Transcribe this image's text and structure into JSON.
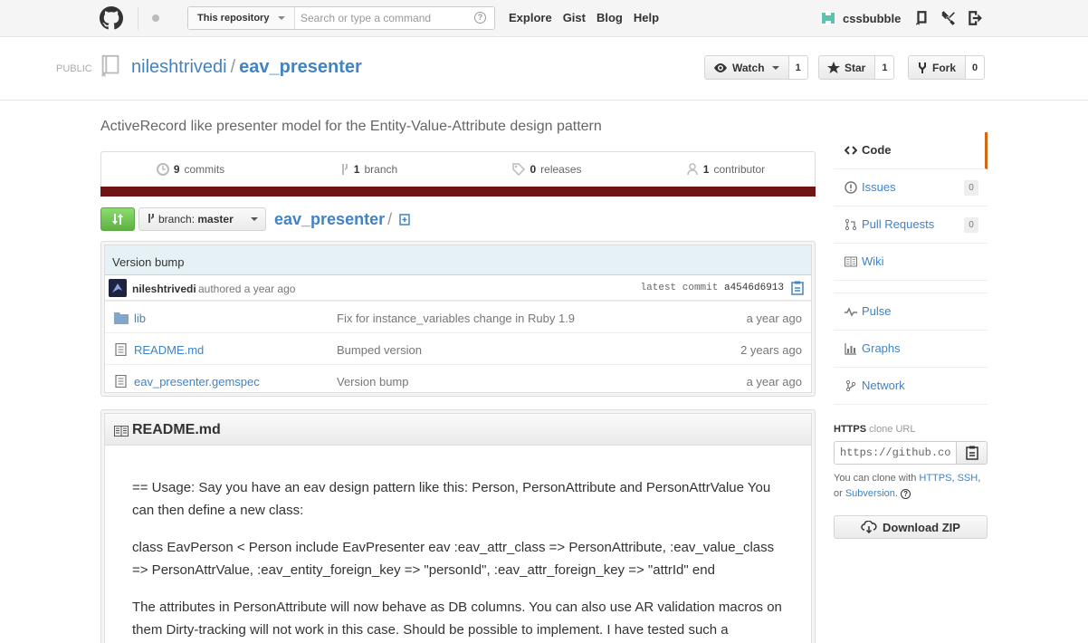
{
  "header": {
    "scope_label": "This repository",
    "search_placeholder": "Search or type a command",
    "search_help": "?",
    "nav": [
      "Explore",
      "Gist",
      "Blog",
      "Help"
    ],
    "username": "cssbubble"
  },
  "repo": {
    "visibility": "PUBLIC",
    "owner": "nileshtrivedi",
    "separator": "/",
    "name": "eav_presenter",
    "watch_label": "Watch",
    "watch_count": "1",
    "star_label": "Star",
    "star_count": "1",
    "fork_label": "Fork",
    "fork_count": "0",
    "description": "ActiveRecord like presenter model for the Entity-Value-Attribute design pattern"
  },
  "stats": {
    "commits_num": "9",
    "commits_label": "commits",
    "branches_num": "1",
    "branches_label": "branch",
    "releases_num": "0",
    "releases_label": "releases",
    "contributors_num": "1",
    "contributors_label": "contributor",
    "language_color": "#701516"
  },
  "toolbar": {
    "branch_prefix": "branch:",
    "branch_name": "master",
    "path_root": "eav_presenter",
    "path_sep": "/"
  },
  "commit": {
    "message": "Version bump",
    "author": "nileshtrivedi",
    "authored": "authored a year ago",
    "latest_label": "latest commit",
    "sha": "a4546d6913"
  },
  "files": [
    {
      "name": "lib",
      "type": "dir",
      "message": "Fix for instance_variables change in Ruby 1.9",
      "age": "a year ago"
    },
    {
      "name": "README.md",
      "type": "file",
      "message": "Bumped version",
      "age": "2 years ago"
    },
    {
      "name": "eav_presenter.gemspec",
      "type": "file",
      "message": "Version bump",
      "age": "a year ago"
    }
  ],
  "readme": {
    "title": "README.md",
    "paragraphs": [
      "== Usage: Say you have an eav design pattern like this: Person, PersonAttribute and PersonAttrValue You can then define a new class:",
      "class EavPerson < Person include EavPresenter eav :eav_attr_class => PersonAttribute, :eav_value_class => PersonAttrValue, :eav_entity_foreign_key => \"personId\", :eav_attr_foreign_key => \"attrId\" end",
      "The attributes in PersonAttribute will now behave as DB columns. You can also use AR validation macros on them Dirty-tracking will not work in this case. Should be possible to implement. I have tested such a presenter"
    ]
  },
  "sidebar": {
    "code": "Code",
    "issues": "Issues",
    "issues_count": "0",
    "pulls": "Pull Requests",
    "pulls_count": "0",
    "wiki": "Wiki",
    "pulse": "Pulse",
    "graphs": "Graphs",
    "network": "Network",
    "clone_proto": "HTTPS",
    "clone_suffix": "clone URL",
    "clone_value": "https://github.com/nileshtrivedi/eav_presenter.git",
    "clone_help_prefix": "You can clone with",
    "clone_https": "HTTPS",
    "clone_ssh": "SSH",
    "clone_or": "or",
    "clone_svn": "Subversion",
    "download": "Download ZIP"
  },
  "colors": {
    "link": "#4183c4",
    "active_tab": "#d26911",
    "compare_green": "#60b044"
  }
}
